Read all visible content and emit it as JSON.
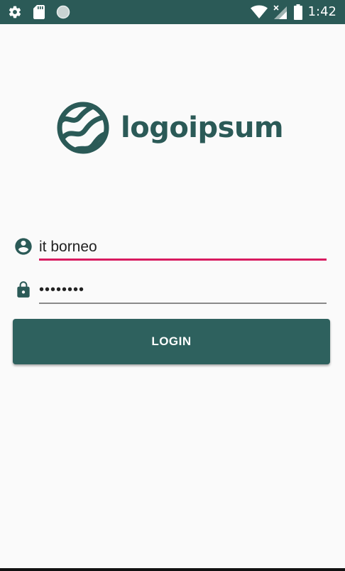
{
  "status_bar": {
    "time": "1:42",
    "icons": [
      "settings-gear-icon",
      "sd-card-icon",
      "sync-circle-icon",
      "wifi-icon",
      "signal-x-icon",
      "battery-icon"
    ],
    "background_color": "#2b5a57"
  },
  "logo": {
    "text": "logoipsum",
    "icon": "logo-mark-icon",
    "color": "#2b5a57"
  },
  "username": {
    "icon": "account-circle-icon",
    "value": "it borneo",
    "underline_color": "#d81b60"
  },
  "password": {
    "icon": "lock-icon",
    "value": "••••••••",
    "underline_color": "#8a8a8a"
  },
  "login_button": {
    "label": "LOGIN",
    "color": "#2e615e"
  }
}
